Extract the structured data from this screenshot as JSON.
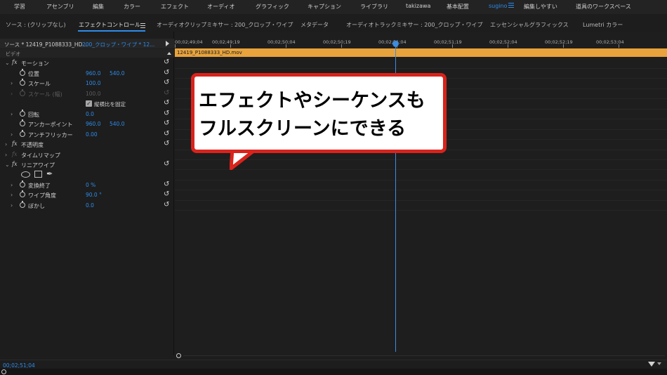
{
  "workspaces": {
    "items": [
      "学習",
      "アセンブリ",
      "編集",
      "カラー",
      "エフェクト",
      "オーディオ",
      "グラフィック",
      "キャプション",
      "ライブラリ",
      "takizawa",
      "基本配置",
      "sugino",
      "編集しやすい",
      "道具のワークスペース"
    ],
    "active": "sugino",
    "active_color": "#2d8ceb"
  },
  "tabs": {
    "source": "ソース : (クリップなし)",
    "effect_controls": "エフェクトコントロール",
    "audio_clip_mixer": "オーディオクリップミキサー : 200_クロップ・ワイプ",
    "metadata": "メタデータ",
    "audio_track_mixer": "オーディオトラックミキサー : 200_クロップ・ワイプ",
    "essential_graphics": "エッセンシャルグラフィックス",
    "lumetri": "Lumetri カラー"
  },
  "effect_panel": {
    "source_clip": "ソース * 12419_P1088333_HD...",
    "sequence_clip": "200_クロップ・ワイプ * 12...",
    "video_header": "ビデオ",
    "motion": {
      "label": "モーション",
      "position": {
        "label": "位置",
        "x": "960.0",
        "y": "540.0"
      },
      "scale": {
        "label": "スケール",
        "value": "100.0"
      },
      "scale_width": {
        "label": "スケール (幅)",
        "value": "100.0"
      },
      "uniform_scale": {
        "label": "縦横比を固定",
        "checked": true
      },
      "rotation": {
        "label": "回転",
        "value": "0.0"
      },
      "anchor": {
        "label": "アンカーポイント",
        "x": "960.0",
        "y": "540.0"
      },
      "anti_flicker": {
        "label": "アンチフリッカー",
        "value": "0.00"
      }
    },
    "opacity": {
      "label": "不透明度"
    },
    "time_remap": {
      "label": "タイムリマップ"
    },
    "linear_wipe": {
      "label": "リニアワイプ",
      "completion": {
        "label": "変換終了",
        "value": "0 %"
      },
      "wipe_angle": {
        "label": "ワイプ角度",
        "value": "90.0 °"
      },
      "feather": {
        "label": "ぼかし",
        "value": "0.0"
      }
    }
  },
  "timeline": {
    "ticks": [
      "00;02;49;04",
      "00;02;49;19",
      "00;02;50;04",
      "00;02;50;19",
      "00;02;51;04",
      "00;02;51;19",
      "00;02;52;04",
      "00;02;52;19",
      "00;02;53;04"
    ],
    "clip_name": "12419_P1088333_HD.mov",
    "clip_color": "#e8a33d",
    "playhead_color": "#3e8ce0"
  },
  "bottom": {
    "timecode": "00;02;51;04"
  },
  "callout": {
    "line1": "エフェクトやシーケンスも",
    "line2": "フルスクリーンにできる",
    "border_color": "#d9231c"
  }
}
